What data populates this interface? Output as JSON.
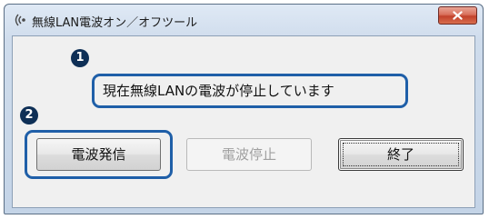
{
  "window": {
    "title": "無線LAN電波オン／オフツール",
    "close_label": "X"
  },
  "annotations": {
    "marker_1": "1",
    "marker_2": "2"
  },
  "status": {
    "message": "現在無線LANの電波が停止しています"
  },
  "buttons": {
    "start_label": "電波発信",
    "stop_label": "電波停止",
    "exit_label": "終了"
  },
  "colors": {
    "callout_outline": "#1f5fa8",
    "marker_fill": "#0e2f56"
  }
}
